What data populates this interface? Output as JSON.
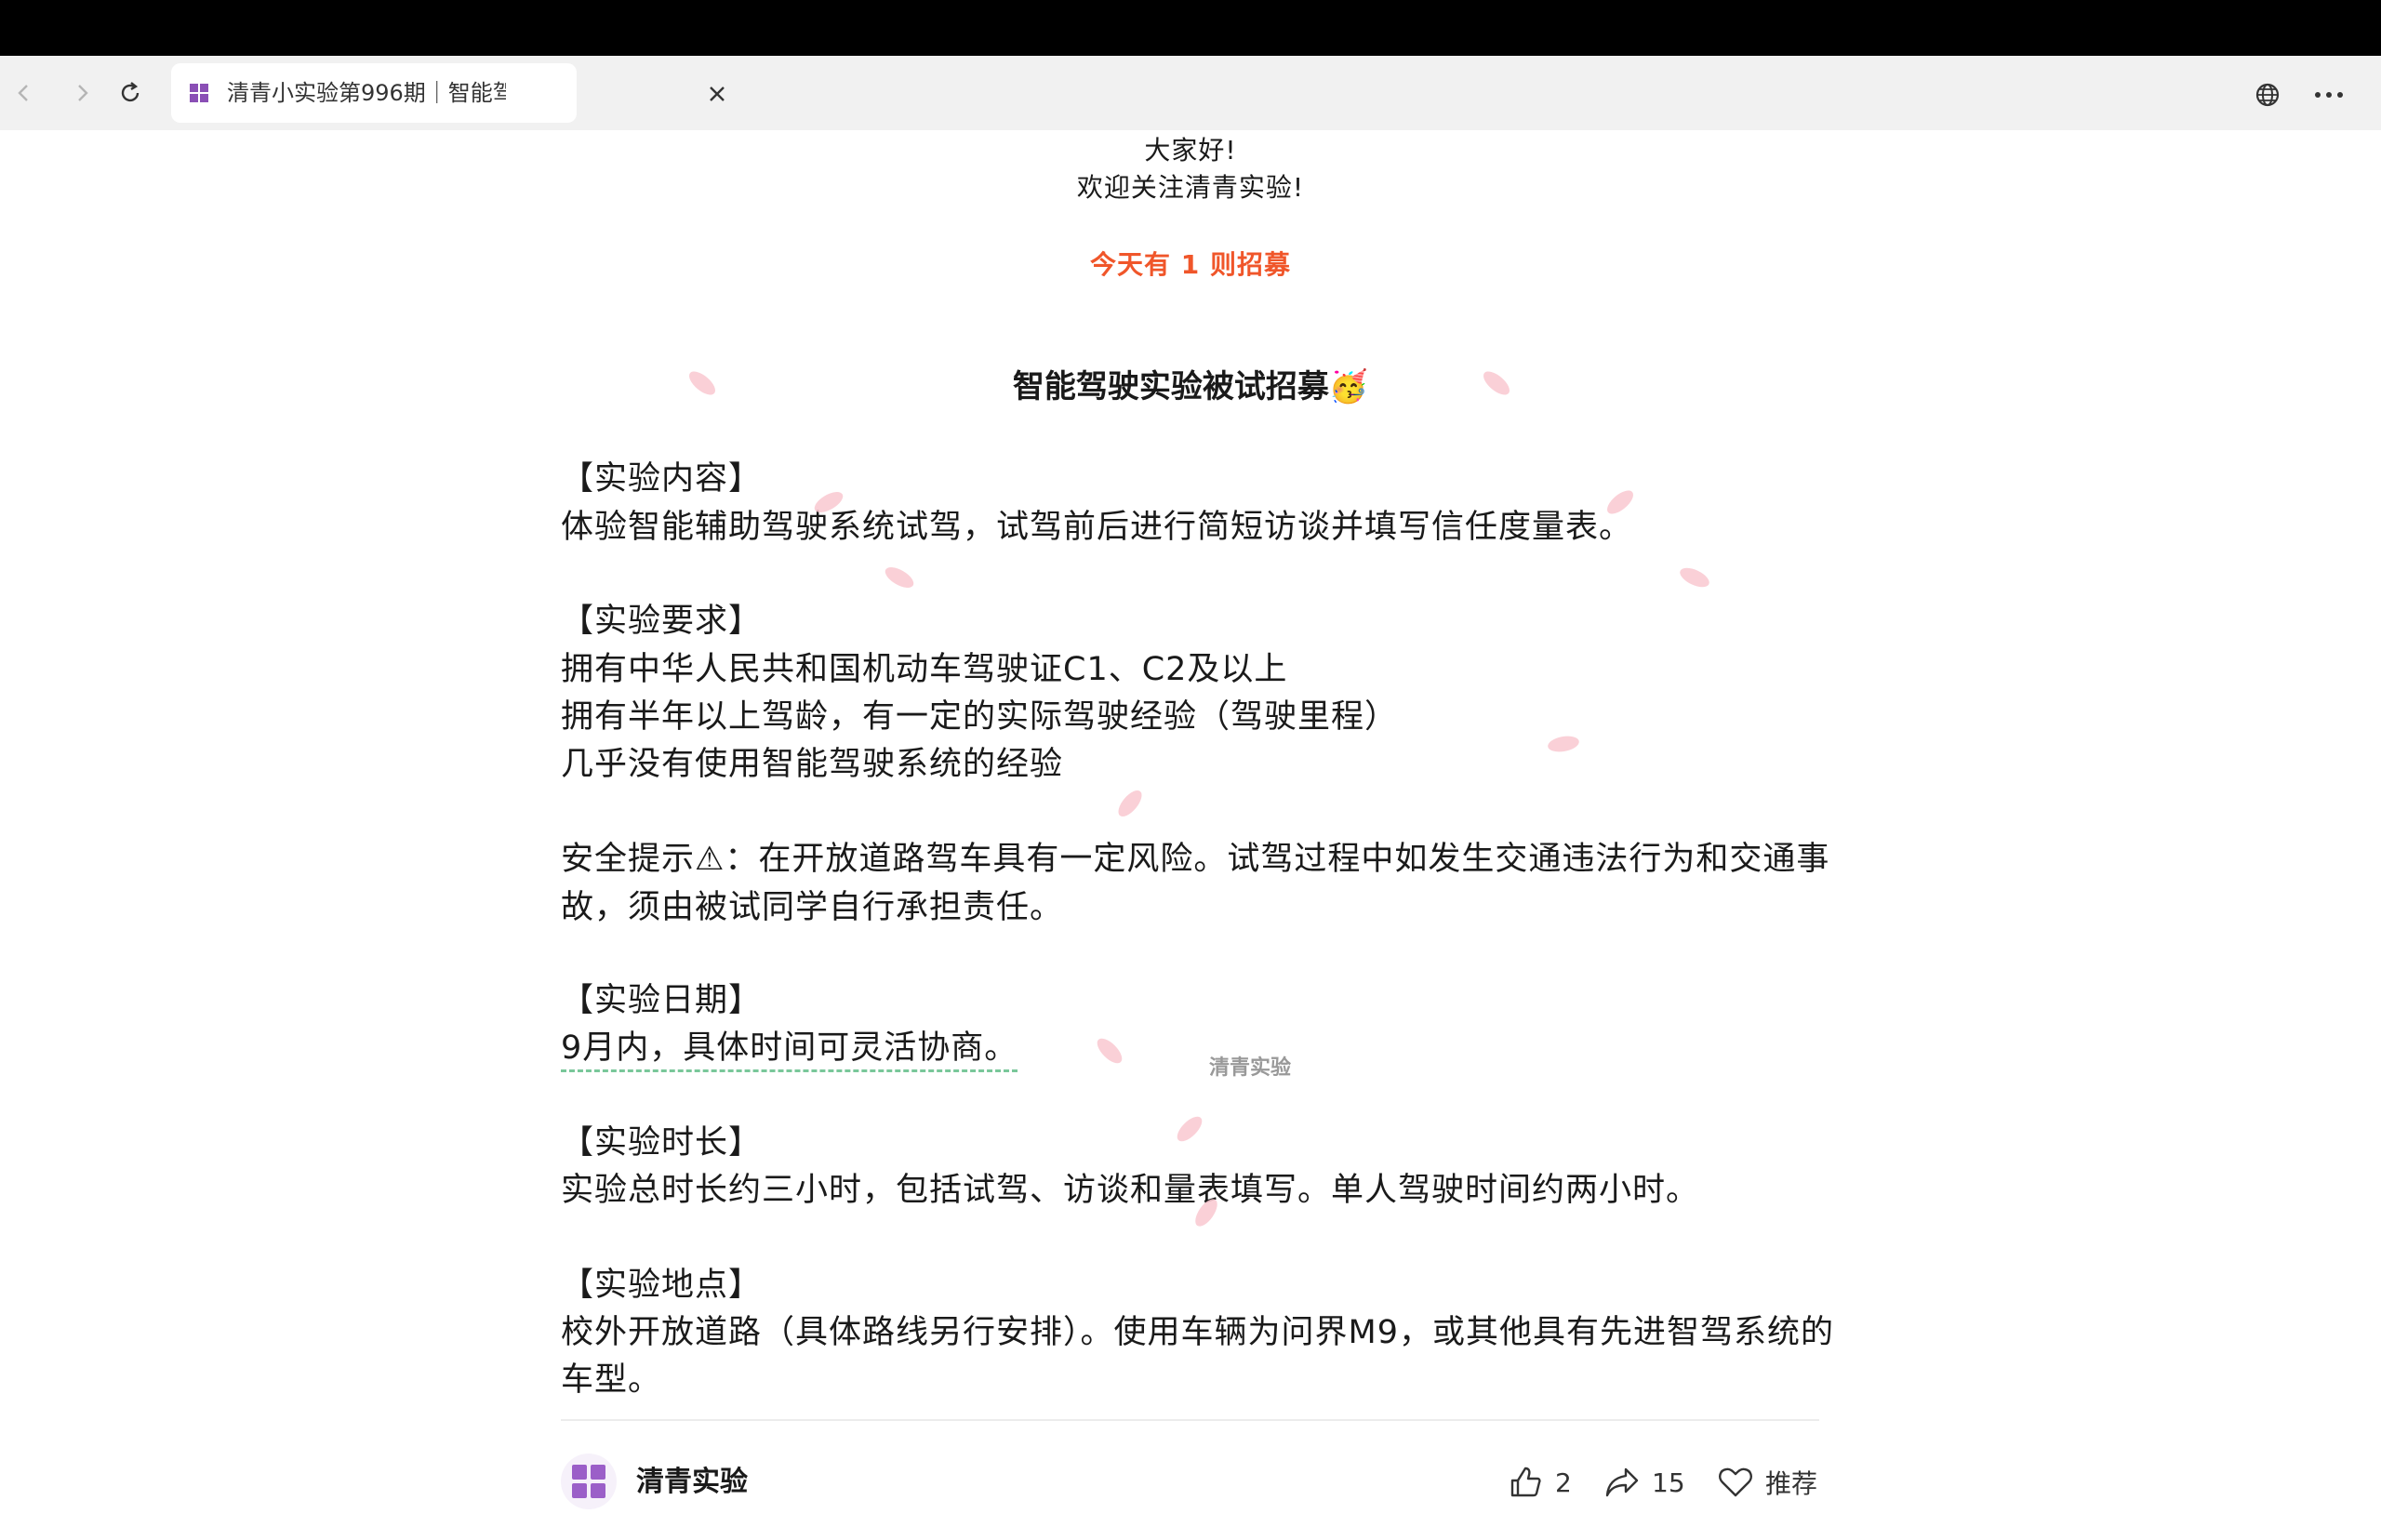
{
  "browser": {
    "tab_title": "清青小实验第996期｜智能驾",
    "icons": [
      "back-icon",
      "forward-icon",
      "reload-icon",
      "favicon-icon",
      "close-icon",
      "globe-icon",
      "more-icon"
    ]
  },
  "article": {
    "greeting": "大家好!",
    "welcome": "欢迎关注清青实验!",
    "today": "今天有 1 则招募",
    "headline": "智能驾驶实验被试招募🥳",
    "content_heading": "【实验内容】",
    "content_text": "体验智能辅助驾驶系统试驾，试驾前后进行简短访谈并填写信任度量表。",
    "requirements_heading": "【实验要求】",
    "req1": "拥有中华人民共和国机动车驾驶证C1、C2及以上",
    "req2": "拥有半年以上驾龄，有一定的实际驾驶经验（驾驶里程）",
    "req3": "几乎没有使用智能驾驶系统的经验",
    "safety1": "安全提示⚠：在开放道路驾车具有一定风险。试驾过程中如发生交通违法行为和交通事",
    "safety2": "故，须由被试同学自行承担责任。",
    "date_heading": "【实验日期】",
    "date_text": "9月内，具体时间可灵活协商。",
    "duration_heading": "【实验时长】",
    "duration_text": "实验总时长约三小时，包括试驾、访谈和量表填写。单人驾驶时间约两小时。",
    "location_heading": "【实验地点】",
    "location1": "校外开放道路（具体路线另行安排）。使用车辆为问界M9，或其他具有先进智驾系统的",
    "location2": "车型。",
    "watermark": "清青实验"
  },
  "footer": {
    "account_name": "清青实验",
    "likes": "2",
    "shares": "15",
    "recommend": "推荐"
  },
  "colors": {
    "accent": "#f0562a",
    "petal": "#f9c8d0",
    "dashed_underline": "#79c79a"
  }
}
